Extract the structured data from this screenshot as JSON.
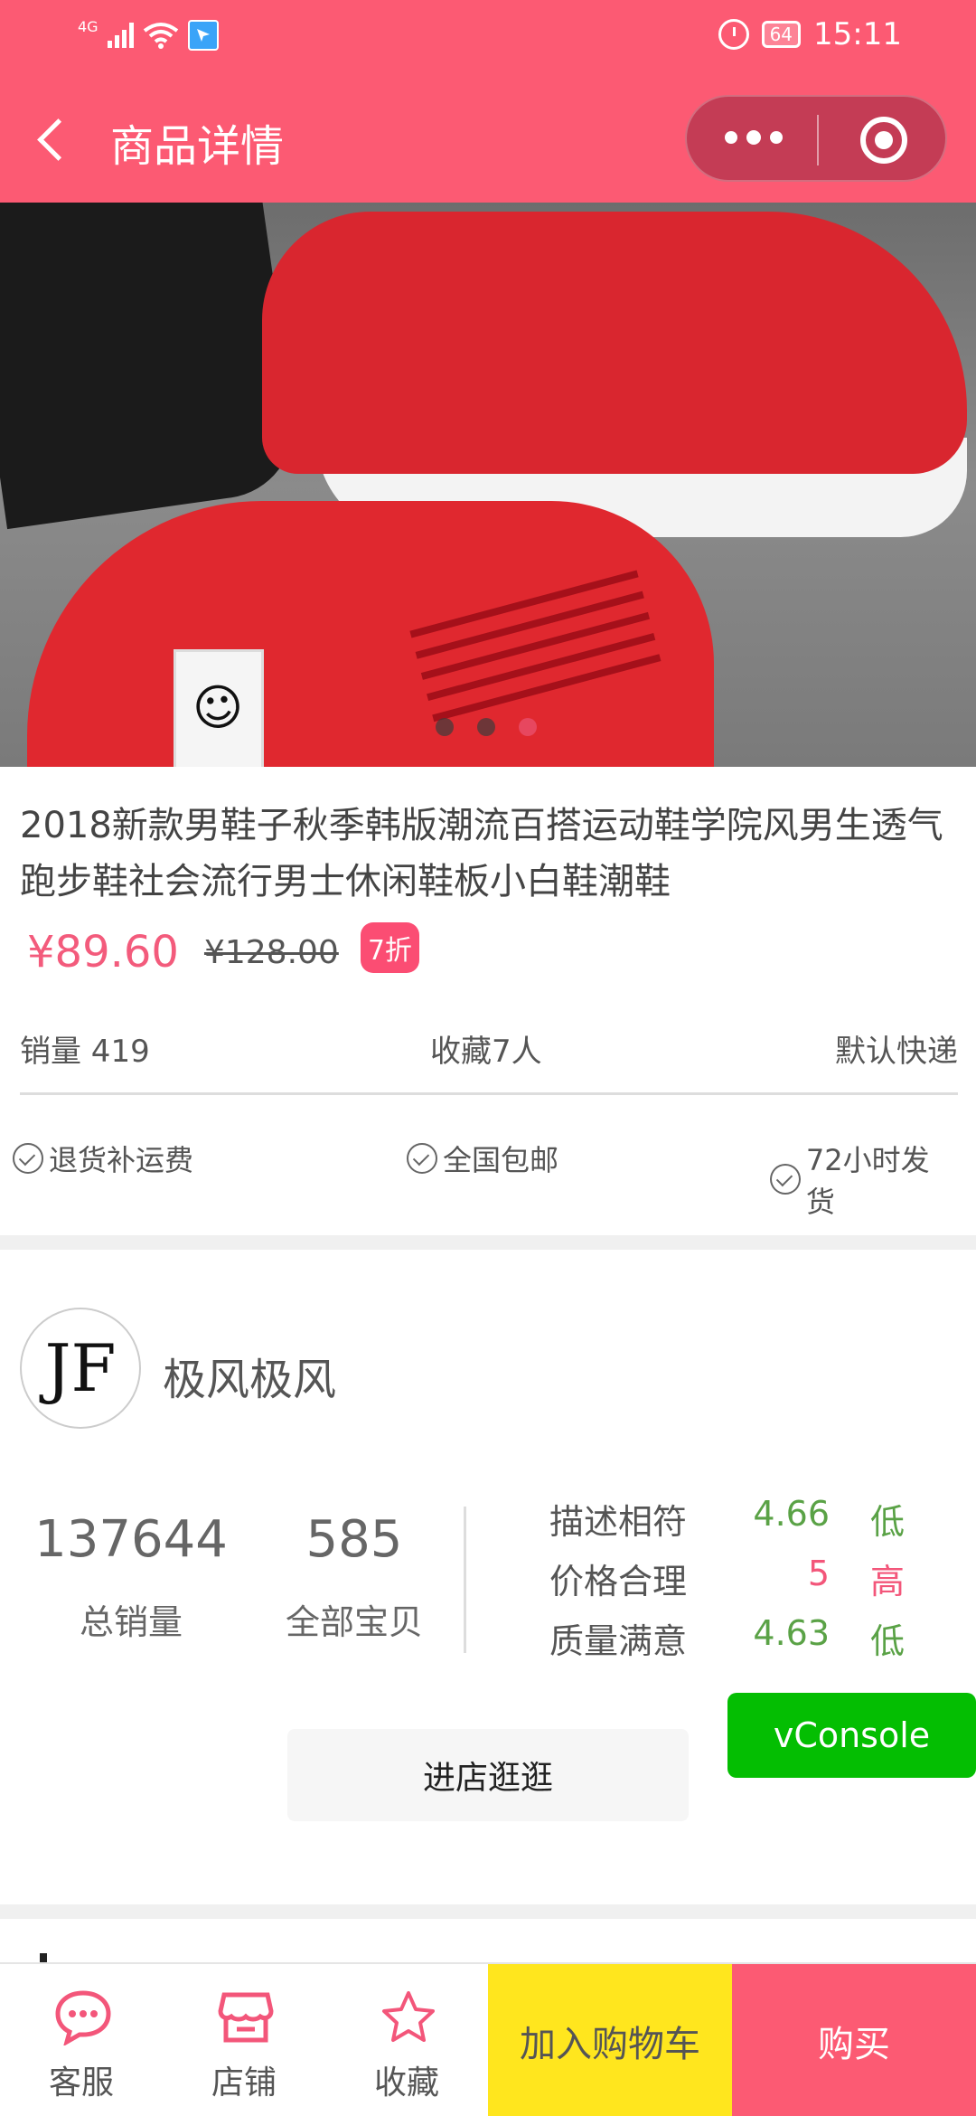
{
  "status_bar": {
    "network": "4G",
    "battery": "64",
    "time": "15:11"
  },
  "header": {
    "title": "商品详情"
  },
  "gallery": {
    "dot_count": 3,
    "active_index": 2
  },
  "product": {
    "title": "2018新款男鞋子秋季韩版潮流百搭运动鞋学院风男生透气跑步鞋社会流行男士休闲鞋板小白鞋潮鞋",
    "price": "¥89.60",
    "original_price": "¥128.00",
    "discount": "7折",
    "sales": "销量 419",
    "favorites": "收藏7人",
    "shipping": "默认快递",
    "guarantees": [
      "退货补运费",
      "全国包邮",
      "72小时发货"
    ]
  },
  "shop": {
    "logo_text": "JF",
    "name": "极风极风",
    "total_sales": "137644",
    "total_sales_label": "总销量",
    "all_items": "585",
    "all_items_label": "全部宝贝",
    "ratings": [
      {
        "label": "描述相符",
        "score": "4.66",
        "level": "低",
        "color": "#5aa246"
      },
      {
        "label": "价格合理",
        "score": "5",
        "level": "高",
        "color": "#f3567a"
      },
      {
        "label": "质量满意",
        "score": "4.63",
        "level": "低",
        "color": "#5aa246"
      }
    ],
    "enter_button": "进店逛逛"
  },
  "vconsole": "vConsole",
  "bottom_bar": {
    "service": "客服",
    "store": "店铺",
    "favorite": "收藏",
    "add_to_cart": "加入购物车",
    "buy": "购买"
  },
  "colors": {
    "brand": "#fc5a73",
    "cart": "#ffe61e",
    "vconsole": "#04be02"
  }
}
